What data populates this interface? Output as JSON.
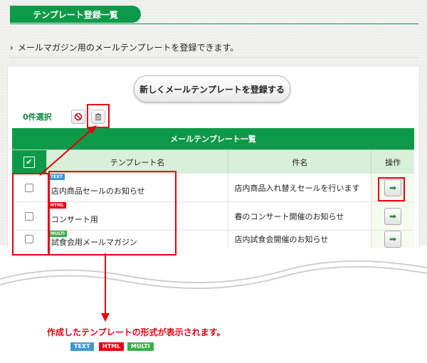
{
  "header": {
    "title": "テンプレート登録一覧"
  },
  "subtitle": "メールマガジン用のメールテンプレートを登録できます。",
  "register_button": "新しくメールテンプレートを登録する",
  "selection_count": "0件選択",
  "table": {
    "title": "メールテンプレート一覧",
    "columns": [
      "テンプレート名",
      "件名",
      "操作"
    ],
    "rows": [
      {
        "format": "TEXT",
        "name": "店内商品セールのお知らせ",
        "subject": "店内商品入れ替えセールを行います"
      },
      {
        "format": "HTML",
        "name": "コンサート用",
        "subject": "春のコンサート開催のお知らせ"
      },
      {
        "format": "MULTI",
        "name": "試食会用メールマガジン",
        "subject": "店内試食会開催のお知らせ"
      }
    ]
  },
  "caption": "作成したテンプレートの形式が表示されます。",
  "legend": [
    "TEXT",
    "HTML",
    "MULTI"
  ],
  "colors": {
    "brand_green": "#0d9a48",
    "annotation_red": "#e60012",
    "text_badge": "#3d98d2",
    "html_badge": "#e60012",
    "multi_badge": "#36b14a"
  },
  "icons": [
    "chevron-right-icon",
    "deselect-icon",
    "trash-icon",
    "edit-arrow-icon",
    "checkbox-icon"
  ]
}
